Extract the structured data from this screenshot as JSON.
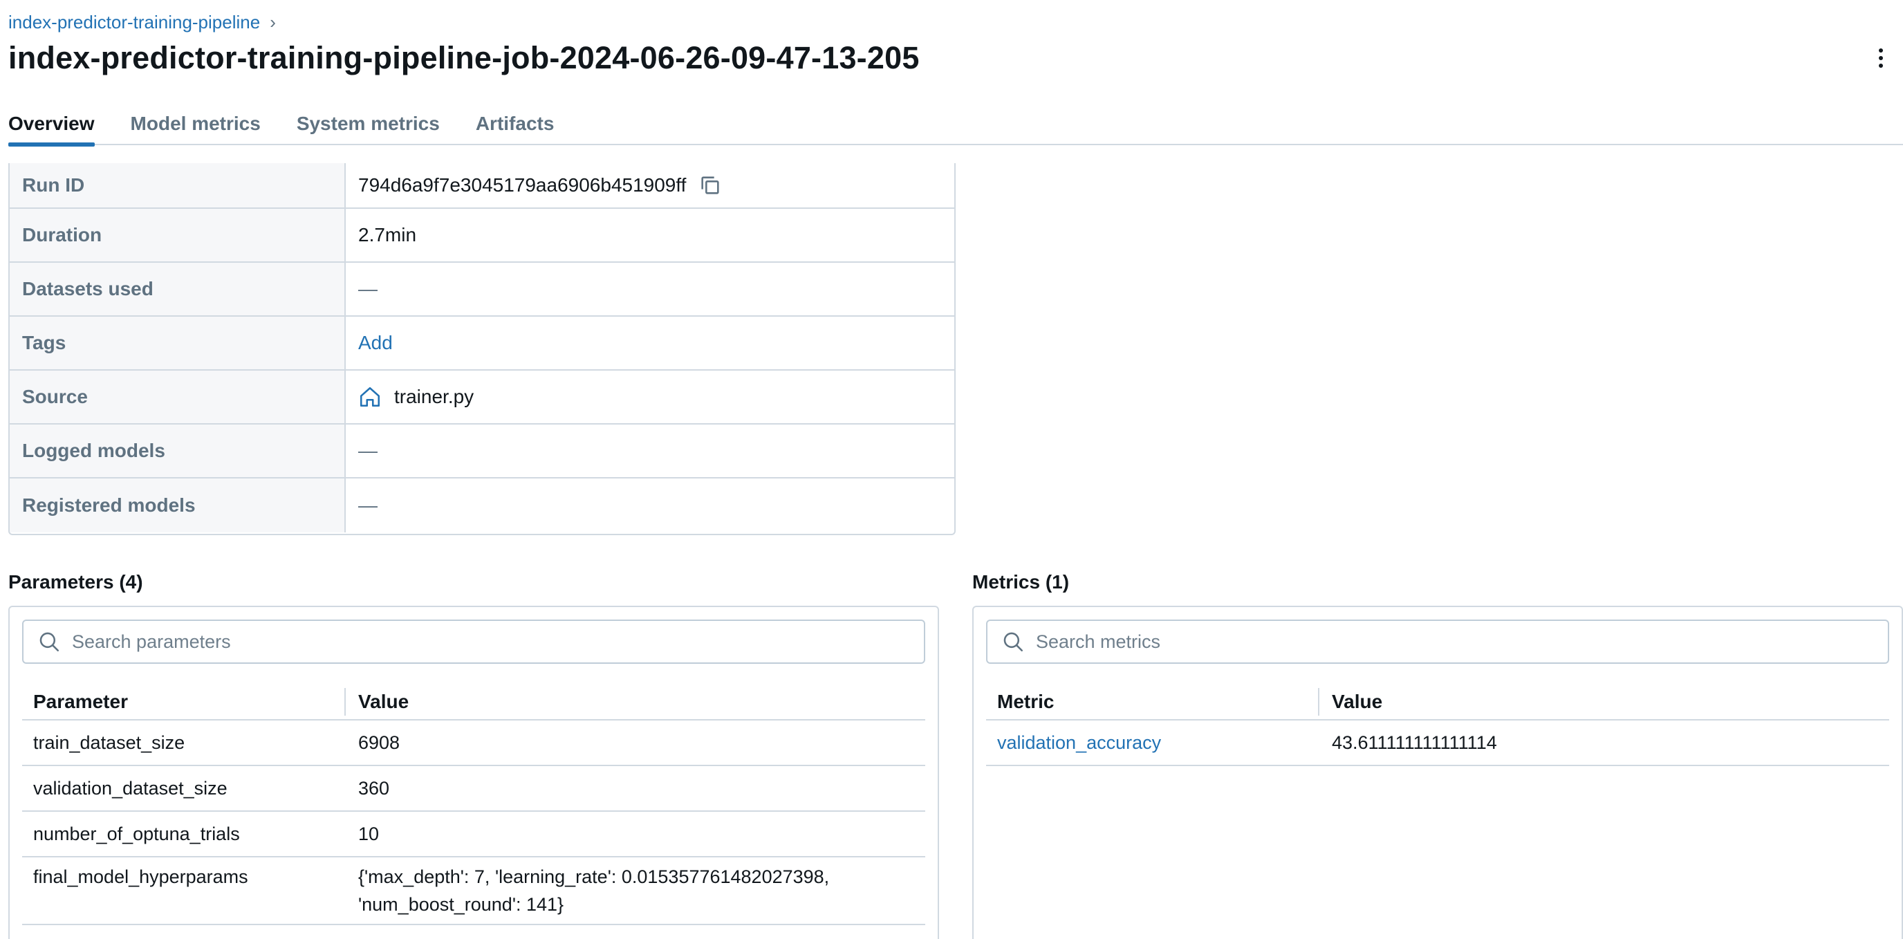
{
  "breadcrumb": {
    "parent": "index-predictor-training-pipeline",
    "separator": "›"
  },
  "title": "index-predictor-training-pipeline-job-2024-06-26-09-47-13-205",
  "tabs": [
    {
      "label": "Overview",
      "active": true
    },
    {
      "label": "Model metrics",
      "active": false
    },
    {
      "label": "System metrics",
      "active": false
    },
    {
      "label": "Artifacts",
      "active": false
    }
  ],
  "details": {
    "run_id": {
      "label": "Run ID",
      "value": "794d6a9f7e3045179aa6906b451909ff"
    },
    "duration": {
      "label": "Duration",
      "value": "2.7min"
    },
    "datasets": {
      "label": "Datasets used",
      "value": "—"
    },
    "tags": {
      "label": "Tags",
      "value": "Add"
    },
    "source": {
      "label": "Source",
      "value": "trainer.py"
    },
    "logged_models": {
      "label": "Logged models",
      "value": "—"
    },
    "registered_models": {
      "label": "Registered models",
      "value": "—"
    }
  },
  "parameters": {
    "title": "Parameters (4)",
    "search_placeholder": "Search parameters",
    "col_key": "Parameter",
    "col_value": "Value",
    "rows": [
      {
        "key": "train_dataset_size",
        "value": "6908"
      },
      {
        "key": "validation_dataset_size",
        "value": "360"
      },
      {
        "key": "number_of_optuna_trials",
        "value": "10"
      },
      {
        "key": "final_model_hyperparams",
        "value_line1": "{'max_depth': 7, 'learning_rate': 0.015357761482027398,",
        "value_line2": "'num_boost_round': 141}"
      }
    ]
  },
  "metrics": {
    "title": "Metrics (1)",
    "search_placeholder": "Search metrics",
    "col_key": "Metric",
    "col_value": "Value",
    "rows": [
      {
        "key": "validation_accuracy",
        "value": "43.611111111111114"
      }
    ]
  },
  "colors": {
    "accent": "#2272b4",
    "border": "#d1d9e1",
    "label_bg": "#f6f7f9",
    "muted_text": "#5f7281"
  }
}
